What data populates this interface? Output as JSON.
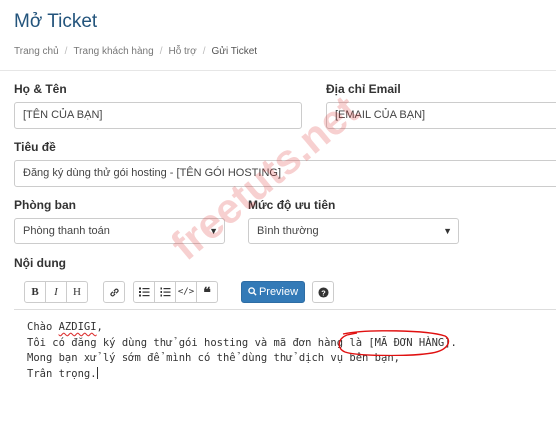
{
  "page": {
    "title": "Mở Ticket"
  },
  "breadcrumb": [
    "Trang chủ",
    "Trang khách hàng",
    "Hỗ trợ",
    "Gửi Ticket"
  ],
  "form": {
    "name_label": "Họ & Tên",
    "name_value": "[TÊN CỦA BẠN]",
    "email_label": "Địa chỉ Email",
    "email_value": "[EMAIL CỦA BẠN]",
    "subject_label": "Tiêu đề",
    "subject_value": "Đăng ký dùng thử gói hosting - [TÊN GÓI HOSTING]",
    "department_label": "Phòng ban",
    "department_value": "Phòng thanh toán",
    "priority_label": "Mức độ ưu tiên",
    "priority_value": "Bình thường",
    "content_label": "Nội dung"
  },
  "toolbar": {
    "bold": "B",
    "italic": "I",
    "heading": "H",
    "preview_label": "Preview",
    "icons": [
      "bold-icon",
      "italic-icon",
      "heading-icon",
      "link-icon",
      "bulleted-list-icon",
      "numbered-list-icon",
      "code-icon",
      "quote-icon",
      "search-icon",
      "help-icon"
    ]
  },
  "editor": {
    "line1_prefix": "Chào ",
    "line1_word": "AZDIGI",
    "line1_suffix": ",",
    "line2": "Tôi có đăng ký dùng thử gói hosting và mã đơn hàng là [MÃ ĐƠN HÀNG].",
    "line3": "Mong bạn xử lý sớm để mình có thể dùng thử dịch vụ bên bạn,",
    "line4": "Trân trọng."
  },
  "watermark": {
    "text": "freetuts.net"
  },
  "colors": {
    "title": "#23547c",
    "primary": "#337ab7",
    "annotation": "#e01010"
  }
}
